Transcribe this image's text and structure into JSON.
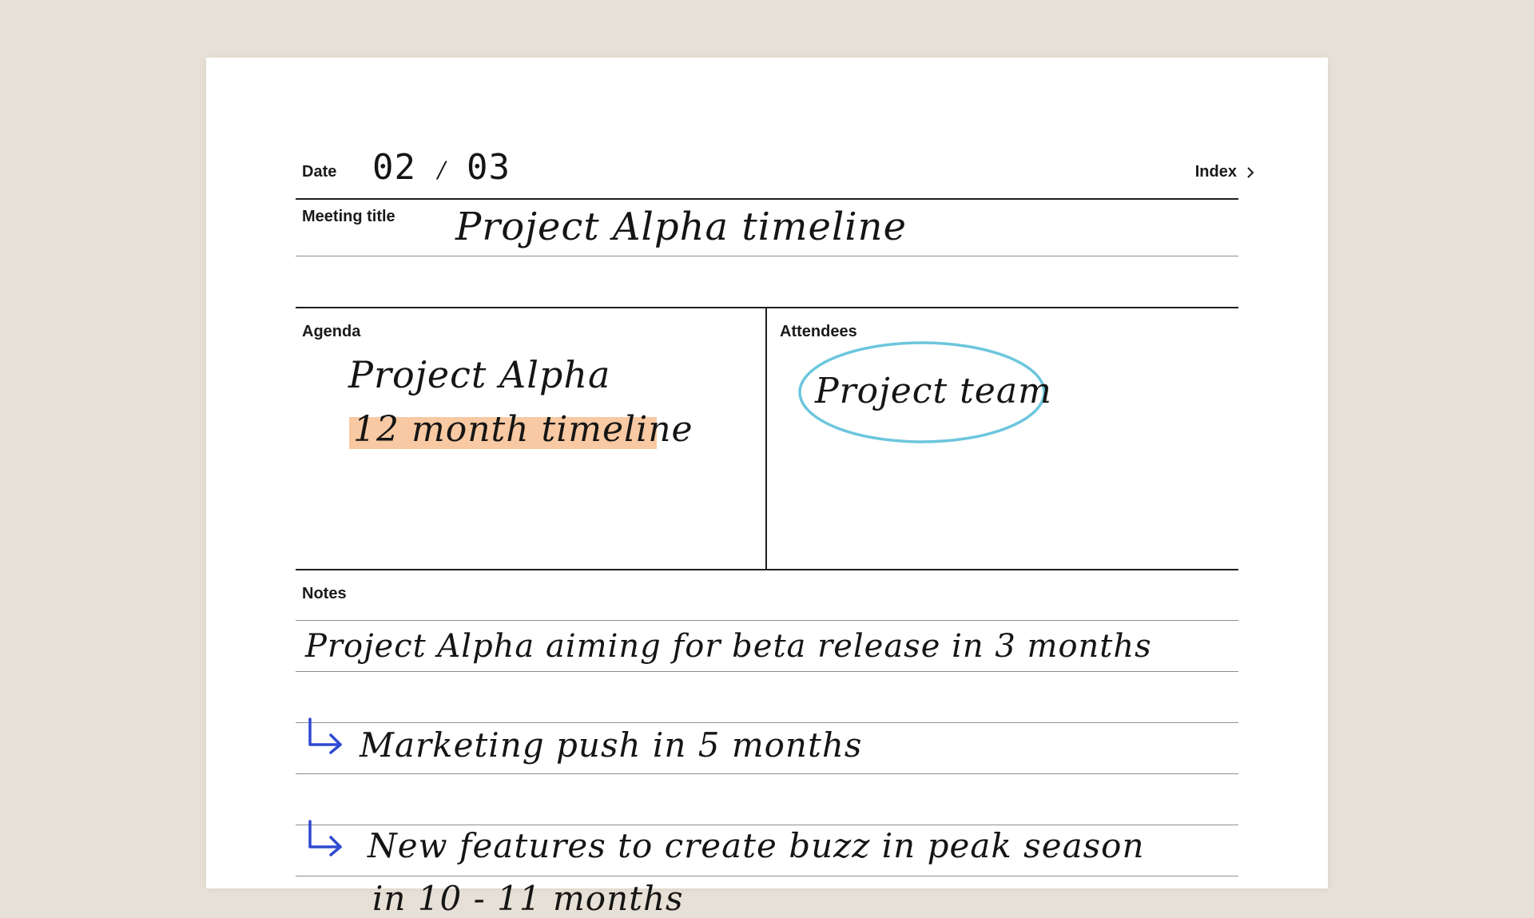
{
  "header": {
    "date_label": "Date",
    "date_month": "02",
    "date_separator": "/",
    "date_day": "03",
    "index_label": "Index",
    "index_icon": "chevron-right-icon"
  },
  "meeting": {
    "title_label": "Meeting title",
    "title_value": "Project Alpha timeline"
  },
  "agenda": {
    "label": "Agenda",
    "lines": [
      "Project Alpha",
      "12 month timeline"
    ],
    "highlight_color": "#f8c9a2"
  },
  "attendees": {
    "label": "Attendees",
    "value": "Project team",
    "circle_color": "#6cc6dd"
  },
  "notes": {
    "label": "Notes",
    "lines": [
      "Project Alpha aiming for beta release in 3 months",
      "Marketing push in 5 months",
      "New features to create buzz in peak season",
      "in 10 - 11 months"
    ],
    "arrow_icon": "arrow-return-icon",
    "arrow_color": "#2f49d1"
  }
}
